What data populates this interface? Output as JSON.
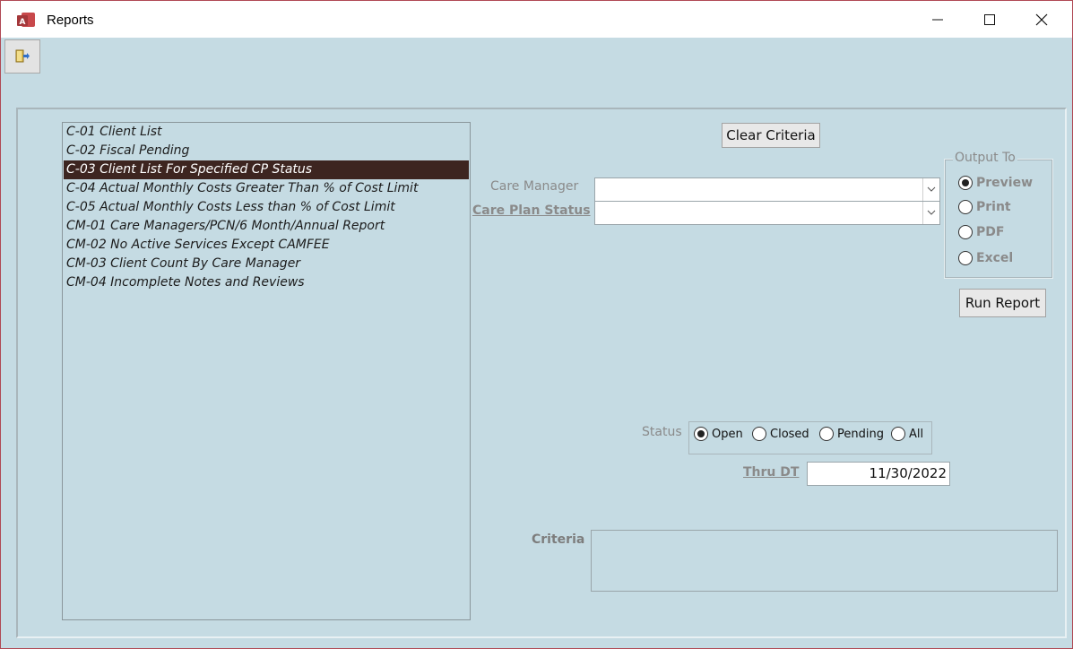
{
  "window": {
    "title": "Reports",
    "app_icon": "access-icon",
    "minimize_glyph": "—",
    "maximize_glyph": "☐",
    "close_glyph": "✕"
  },
  "toolbar": {
    "close_form_icon": "exit-door-icon"
  },
  "reports": [
    "C-01 Client List",
    "C-02 Fiscal Pending",
    "C-03 Client List For Specified CP Status",
    "C-04 Actual Monthly Costs Greater Than % of Cost Limit",
    "C-05 Actual Monthly Costs Less than % of Cost Limit",
    "CM-01 Care Managers/PCN/6 Month/Annual Report",
    "CM-02 No Active Services Except CAMFEE",
    "CM-03 Client Count By Care Manager",
    "CM-04 Incomplete Notes and Reviews"
  ],
  "selected_report": "C-03 Client List For Specified CP Status",
  "buttons": {
    "clear_criteria": "Clear Criteria",
    "run_report": "Run Report"
  },
  "filters": {
    "care_manager_label": "Care Manager",
    "care_manager_value": "",
    "care_plan_status_label": "Care Plan Status",
    "care_plan_status_value": "",
    "dropdown_glyph": "⌄"
  },
  "output": {
    "title": "Output To",
    "options": [
      "Preview",
      "Print",
      "PDF",
      "Excel"
    ],
    "selected": "Preview"
  },
  "status": {
    "label": "Status",
    "options": [
      "Open",
      "Closed",
      "Pending",
      "All"
    ],
    "selected": "Open"
  },
  "thru_dt": {
    "label": "Thru DT",
    "value": "11/30/2022"
  },
  "criteria": {
    "label": "Criteria",
    "value": ""
  },
  "colors": {
    "background": "#c5dbe3",
    "selected_row": "#3d2520",
    "window_border": "#b04a55",
    "access_brand": "#a4373a"
  }
}
